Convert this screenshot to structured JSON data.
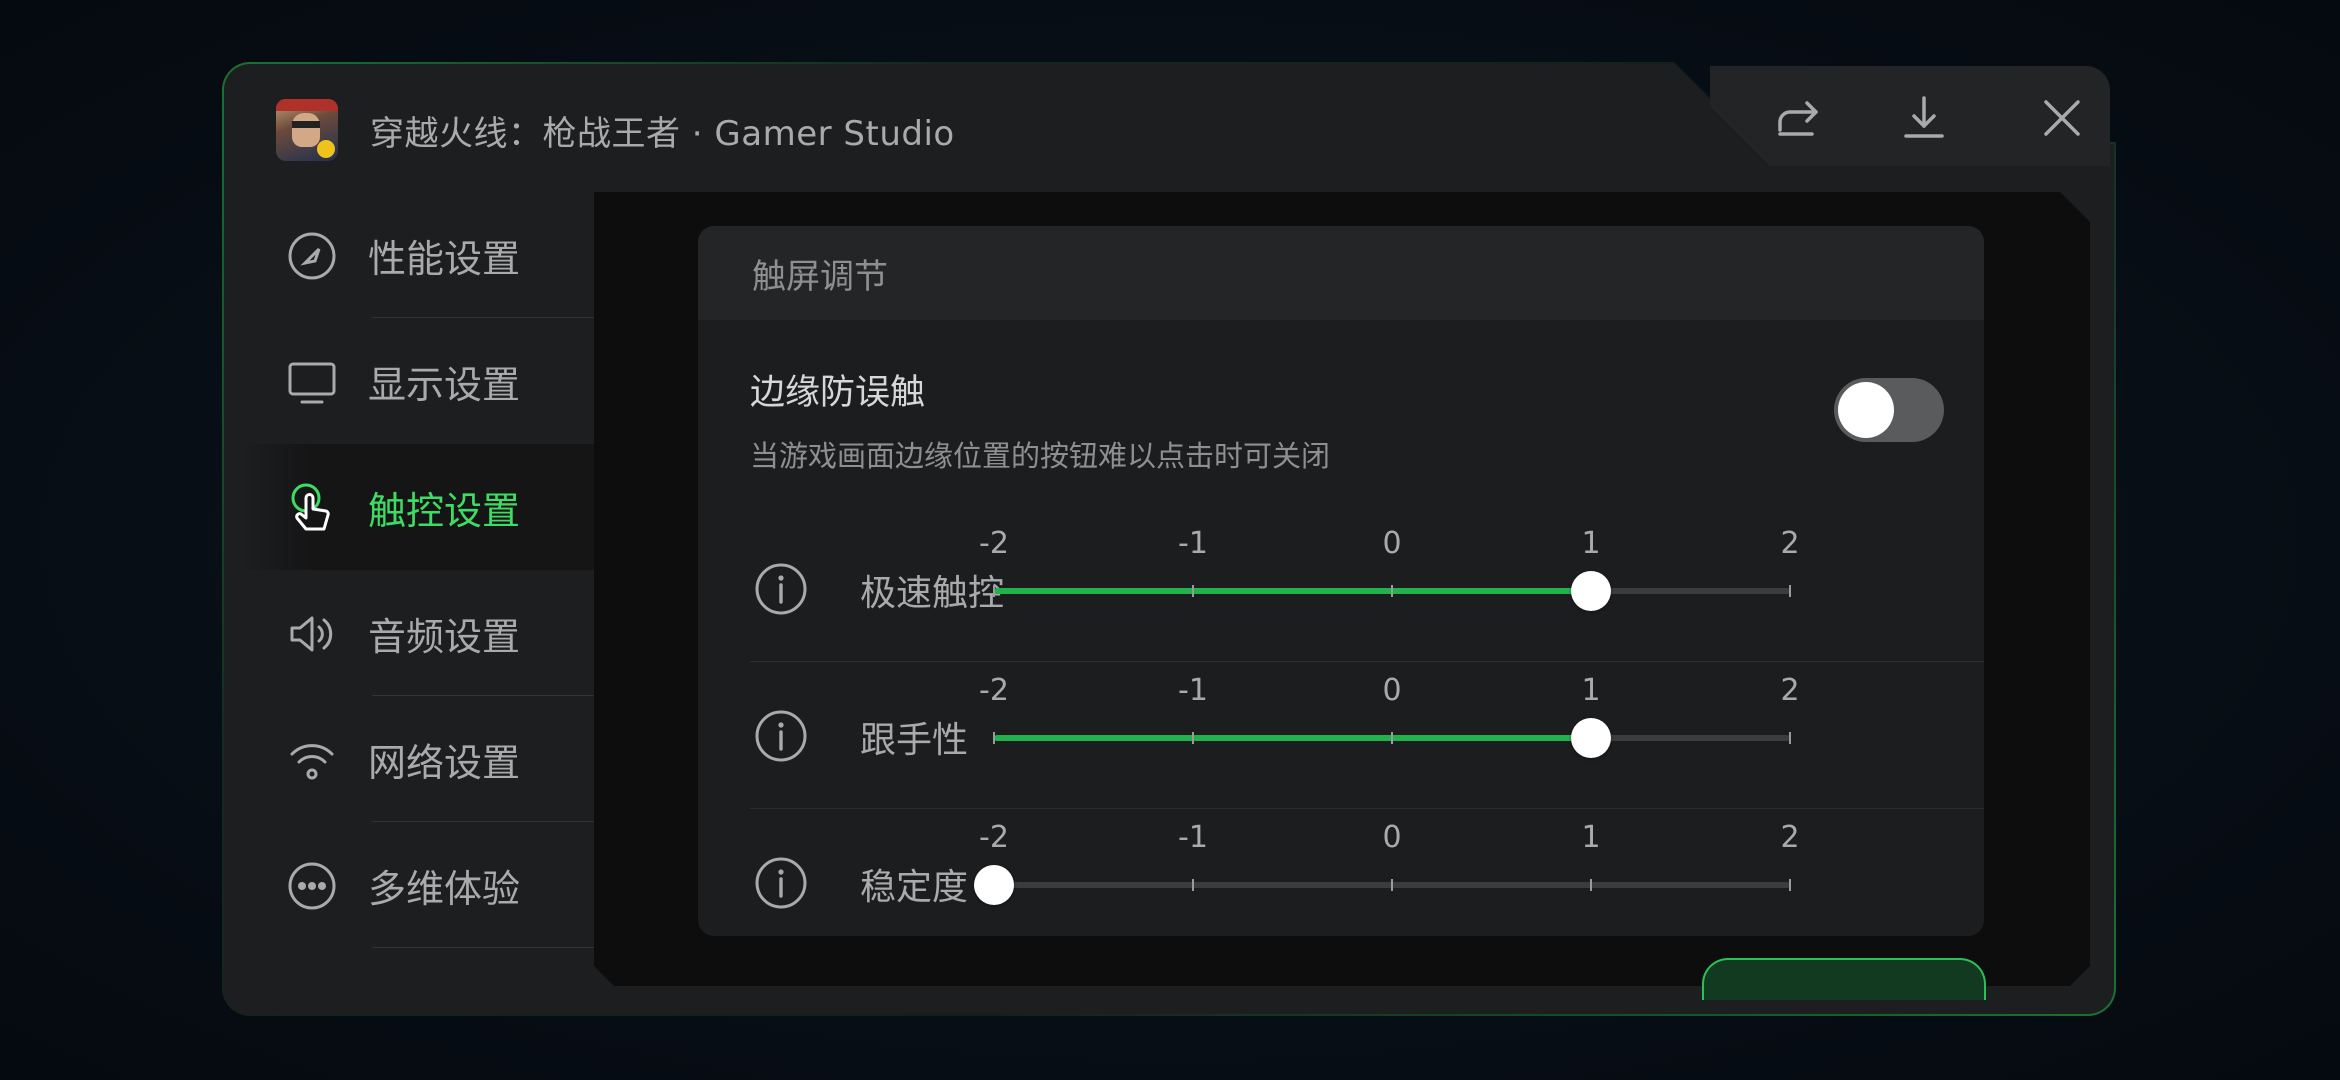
{
  "header": {
    "app_title": "穿越火线：枪战王者 · Gamer Studio",
    "actions": [
      {
        "name": "share-icon"
      },
      {
        "name": "download-icon"
      },
      {
        "name": "close-icon"
      }
    ]
  },
  "sidebar": {
    "items": [
      {
        "label": "性能设置",
        "icon": "speedometer-icon",
        "active": false
      },
      {
        "label": "显示设置",
        "icon": "monitor-icon",
        "active": false
      },
      {
        "label": "触控设置",
        "icon": "touch-icon",
        "active": true
      },
      {
        "label": "音频设置",
        "icon": "speaker-icon",
        "active": false
      },
      {
        "label": "网络设置",
        "icon": "wifi-icon",
        "active": false
      },
      {
        "label": "多维体验",
        "icon": "more-icon",
        "active": false
      }
    ]
  },
  "main": {
    "section_title": "触屏调节",
    "edge_guard": {
      "title": "边缘防误触",
      "description": "当游戏画面边缘位置的按钮难以点击时可关闭",
      "enabled": false
    },
    "sliders": [
      {
        "label": "极速触控",
        "value": 1,
        "ticks": [
          "-2",
          "-1",
          "0",
          "1",
          "2"
        ],
        "min": -2,
        "max": 2
      },
      {
        "label": "跟手性",
        "value": 1,
        "ticks": [
          "-2",
          "-1",
          "0",
          "1",
          "2"
        ],
        "min": -2,
        "max": 2
      },
      {
        "label": "稳定度",
        "value": -2,
        "ticks": [
          "-2",
          "-1",
          "0",
          "1",
          "2"
        ],
        "min": -2,
        "max": 2
      }
    ]
  },
  "colors": {
    "accent": "#3ddc65",
    "track_fill": "#22b24c",
    "panel": "#1d1e20"
  }
}
